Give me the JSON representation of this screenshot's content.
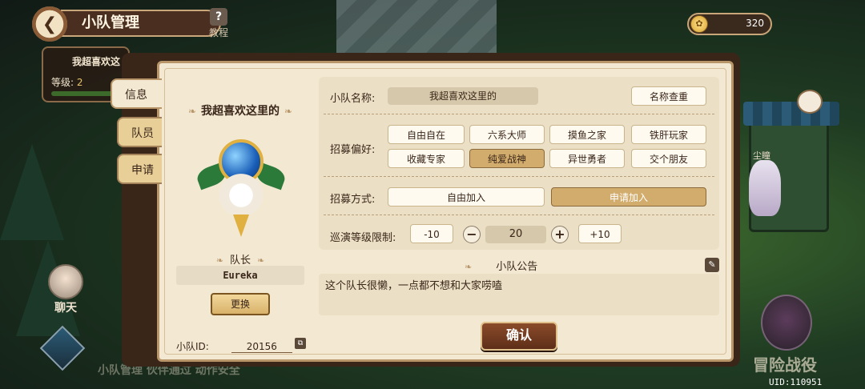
{
  "header": {
    "title": "小队管理",
    "help_label": "教程"
  },
  "currency": {
    "amount": "320",
    "icon": "gold-coin-icon"
  },
  "background_card": {
    "team_name": "我超喜欢这",
    "level_label": "等级:",
    "level_value": "2"
  },
  "left_icons": {
    "chat_label": "聊天",
    "bottom_text": "小队管理 伙伴通过 动作安全"
  },
  "right_icons": {
    "npc_label": "尘瞳",
    "adventure_label": "冒险战役",
    "uid": "UID:110951"
  },
  "tabs": [
    {
      "label": "信息"
    },
    {
      "label": "队员"
    },
    {
      "label": "申请"
    }
  ],
  "team": {
    "title": "我超喜欢这里的",
    "leader_label": "队长",
    "leader_name": "Eureka",
    "swap_label": "更换",
    "id_label": "小队ID:",
    "id_value": "20156"
  },
  "settings": {
    "name_label": "小队名称:",
    "name_value": "我超喜欢这里的",
    "check_name_label": "名称查重",
    "preference_label": "招募偏好:",
    "preferences": [
      "自由自在",
      "六系大师",
      "摸鱼之家",
      "铁肝玩家",
      "收藏专家",
      "纯爱战神",
      "异世勇者",
      "交个朋友"
    ],
    "selected_preference": "纯爱战神",
    "method_label": "招募方式:",
    "methods": [
      "自由加入",
      "申请加入"
    ],
    "selected_method": "申请加入",
    "level_label": "巡演等级限制:",
    "minus10": "-10",
    "minus": "−",
    "level_value": "20",
    "plus": "+",
    "plus10": "+10"
  },
  "notice": {
    "title": "小队公告",
    "text": "这个队长很懒，一点都不想和大家唠嗑"
  },
  "confirm_label": "确认",
  "colors": {
    "accent": "#d2ac6c",
    "panel_bg": "#f3e9d3",
    "frame": "#3a2619"
  }
}
